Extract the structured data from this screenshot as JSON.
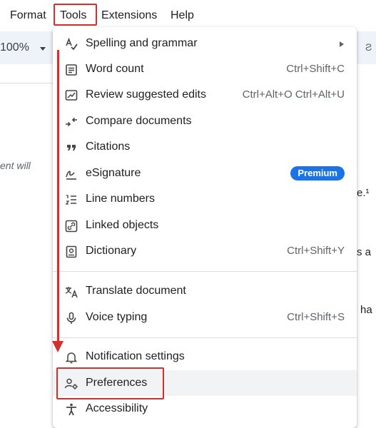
{
  "menubar": {
    "items": [
      "Format",
      "Tools",
      "Extensions",
      "Help"
    ]
  },
  "toolbar": {
    "zoom": "100%",
    "right_glyph": "Ƨ"
  },
  "document": {
    "italic_fragment": "ent will",
    "line_fragments": [
      "e.¹",
      "s a",
      "ha"
    ]
  },
  "tools_menu": {
    "items": [
      {
        "label": "Spelling and grammar",
        "icon": "spellcheck-icon",
        "submenu": true
      },
      {
        "label": "Word count",
        "icon": "word-count-icon",
        "shortcut": "Ctrl+Shift+C"
      },
      {
        "label": "Review suggested edits",
        "icon": "review-edits-icon",
        "shortcut": "Ctrl+Alt+O Ctrl+Alt+U"
      },
      {
        "label": "Compare documents",
        "icon": "compare-icon"
      },
      {
        "label": "Citations",
        "icon": "quote-icon"
      },
      {
        "label": "eSignature",
        "icon": "signature-icon",
        "badge": "Premium"
      },
      {
        "label": "Line numbers",
        "icon": "line-numbers-icon"
      },
      {
        "label": "Linked objects",
        "icon": "link-icon"
      },
      {
        "label": "Dictionary",
        "icon": "dictionary-icon",
        "shortcut": "Ctrl+Shift+Y"
      },
      {
        "label": "Translate document",
        "icon": "translate-icon"
      },
      {
        "label": "Voice typing",
        "icon": "microphone-icon",
        "shortcut": "Ctrl+Shift+S"
      },
      {
        "label": "Notification settings",
        "icon": "bell-icon"
      },
      {
        "label": "Preferences",
        "icon": "preferences-icon"
      },
      {
        "label": "Accessibility",
        "icon": "accessibility-icon"
      }
    ]
  },
  "colors": {
    "highlight_red": "#d32f2f",
    "premium_blue": "#1a73e8",
    "hover_gray": "#f1f3f4",
    "toolbar_bg": "#eef2f9"
  }
}
